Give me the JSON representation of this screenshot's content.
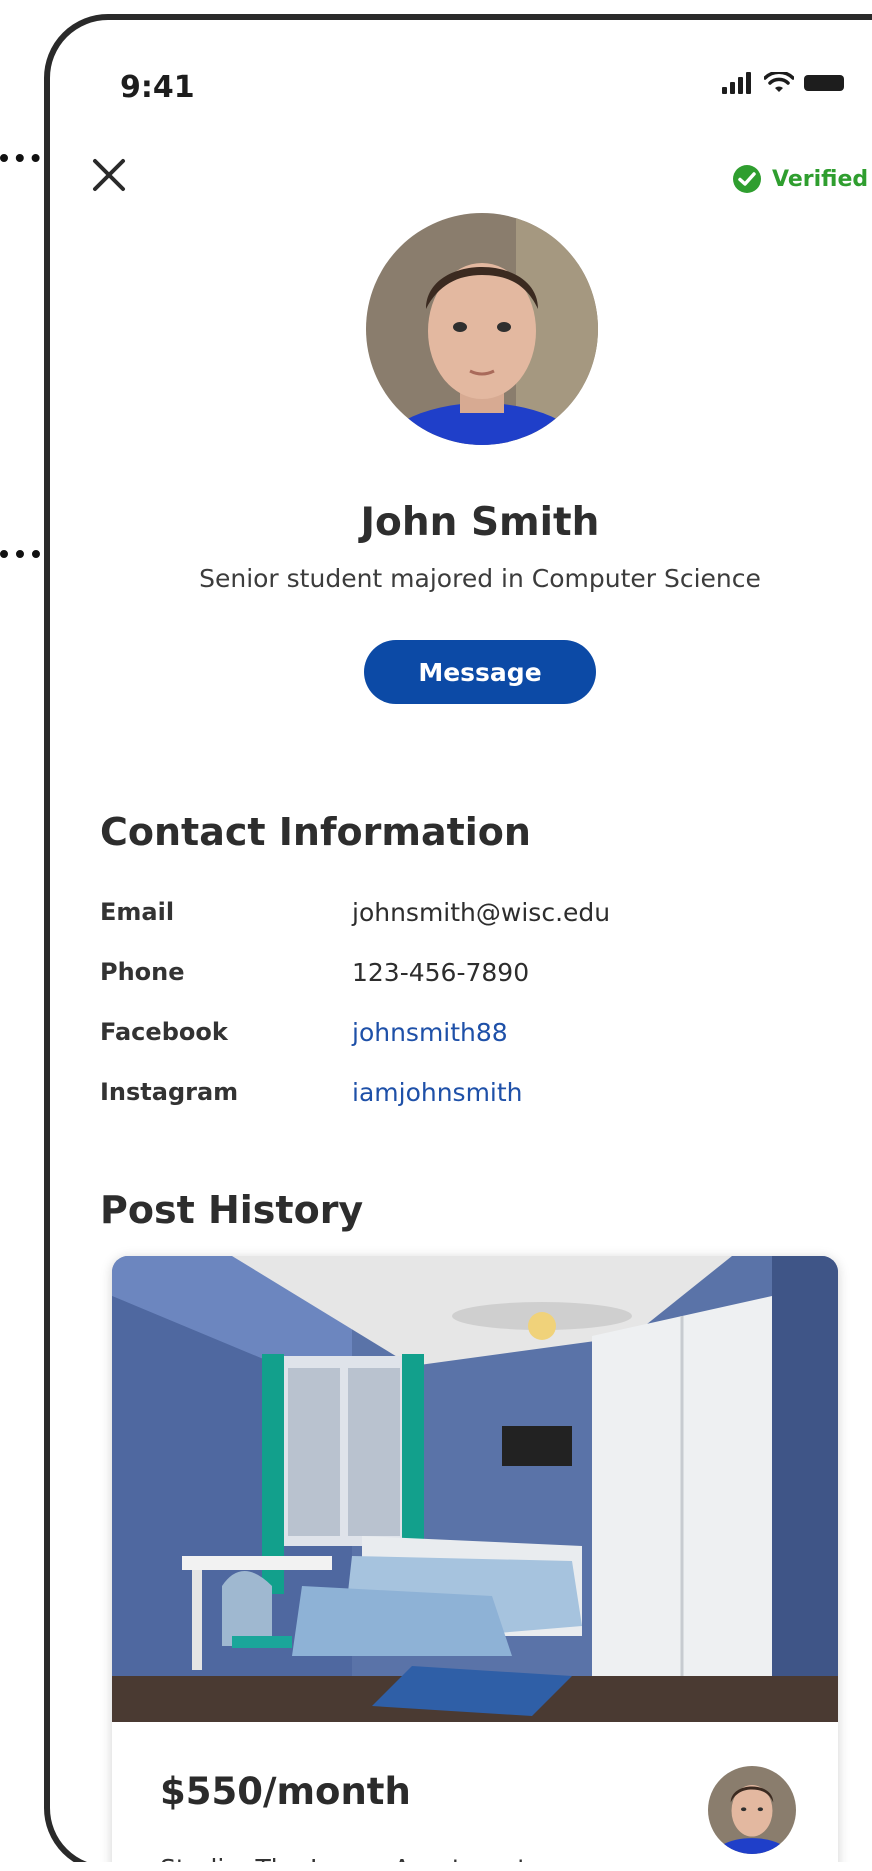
{
  "status_bar": {
    "time": "9:41"
  },
  "header": {
    "verified_label": "Verified"
  },
  "profile": {
    "name": "John Smith",
    "bio": "Senior student majored in Computer Science",
    "message_button": "Message"
  },
  "contact": {
    "title": "Contact Information",
    "rows": [
      {
        "label": "Email",
        "value": "johnsmith@wisc.edu"
      },
      {
        "label": "Phone",
        "value": "123-456-7890"
      },
      {
        "label": "Facebook",
        "value": "johnsmith88"
      },
      {
        "label": "Instagram",
        "value": "iamjohnsmith"
      }
    ]
  },
  "post_history": {
    "title": "Post History",
    "posts": [
      {
        "price": "$550/month",
        "location": "Studio, The James Apartments"
      }
    ]
  },
  "colors": {
    "accent": "#0c4aa6",
    "link": "#1e50a8",
    "verified": "#2f9e2f"
  }
}
